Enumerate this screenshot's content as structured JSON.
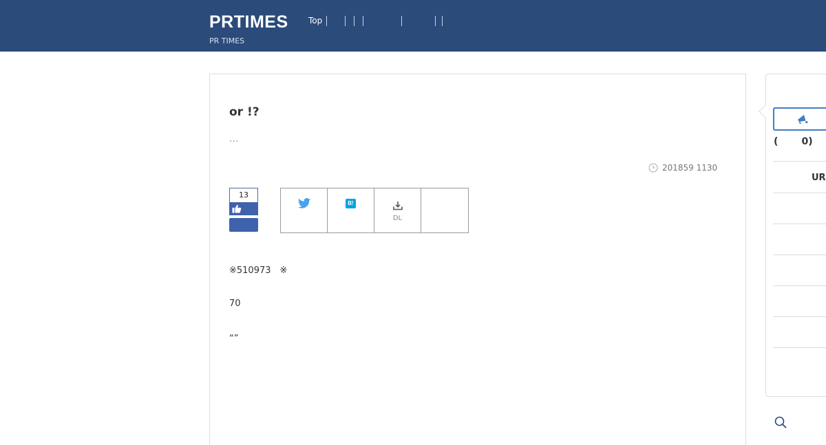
{
  "header": {
    "logo": "PRTIMES",
    "tagline": "PR TIMES",
    "nav_top": "Top"
  },
  "article": {
    "title": "or !?",
    "subtitle": "...",
    "date": "201859 1130",
    "like_count": "13",
    "share": {
      "download_label": "DL"
    },
    "body": [
      "※510973　※",
      "70",
      "“”"
    ]
  },
  "sidebar": {
    "count": "(       0)",
    "url_label": "UR"
  },
  "colors": {
    "header_bg": "#2b4b7b",
    "like_blue": "#3f62ad",
    "twitter_blue": "#4aa1ec",
    "hatena_blue": "#00a4de",
    "accent_border": "#3b7fc4"
  },
  "icons": [
    "clock-icon",
    "thumbs-up-icon",
    "twitter-icon",
    "hatena-bookmark-icon",
    "download-icon",
    "megaphone-icon",
    "search-icon"
  ]
}
